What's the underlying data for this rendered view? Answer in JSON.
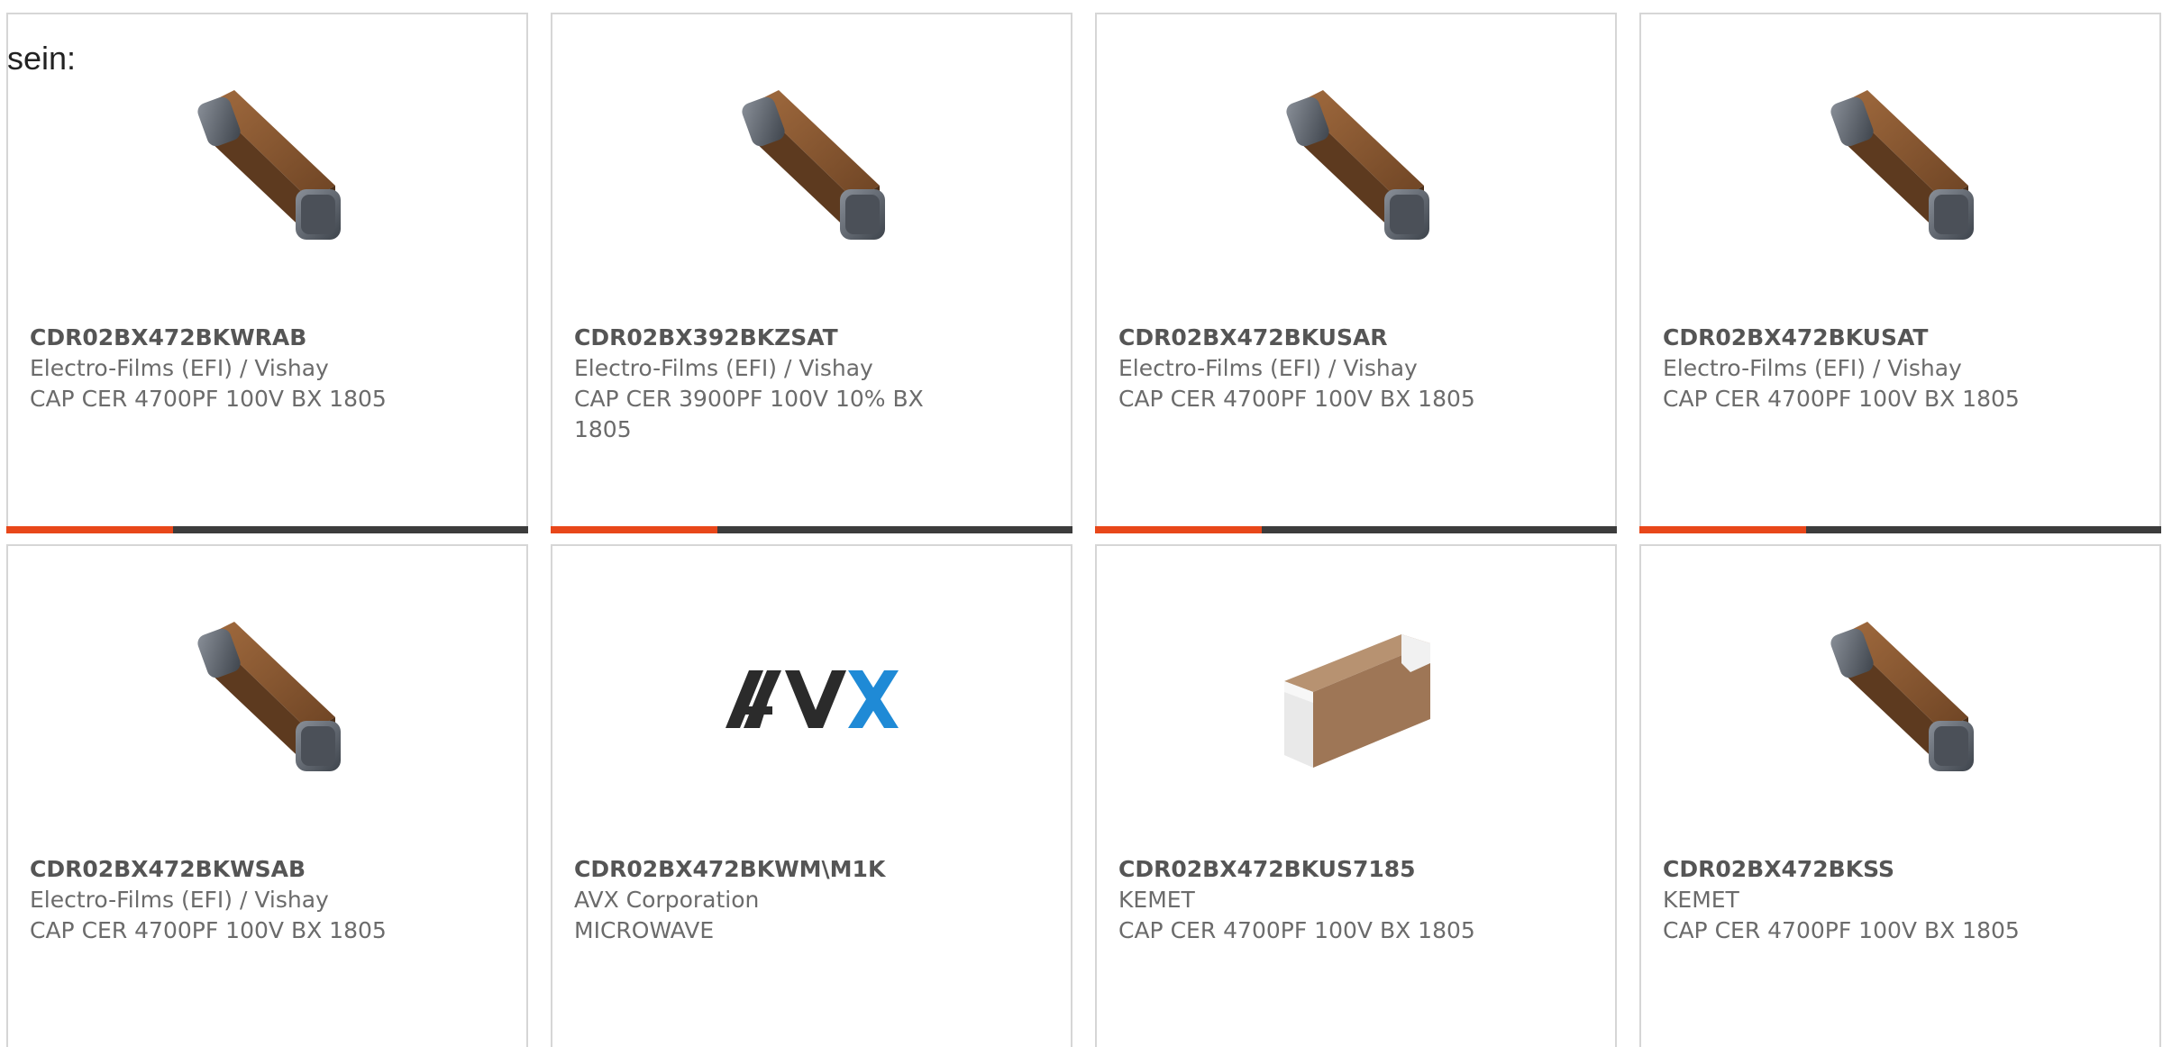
{
  "intro_text": "sein:",
  "colors": {
    "accent": "#e8471a",
    "bar_dark": "#3c3c3c",
    "border": "#d6d6d6",
    "part_number": "#555555",
    "body_text": "#6b6b6b",
    "avx_dark": "#2b2b2b",
    "avx_blue": "#1f8ad6"
  },
  "progress_fraction": 0.32,
  "products": [
    {
      "part_number": "CDR02BX472BKWRAB",
      "manufacturer": "Electro-Films (EFI) / Vishay",
      "description": "CAP CER 4700PF 100V BX 1805",
      "image": "vishay-chip-capacitor"
    },
    {
      "part_number": "CDR02BX392BKZSAT",
      "manufacturer": "Electro-Films (EFI) / Vishay",
      "description": "CAP CER 3900PF 100V 10% BX 1805",
      "image": "vishay-chip-capacitor"
    },
    {
      "part_number": "CDR02BX472BKUSAR",
      "manufacturer": "Electro-Films (EFI) / Vishay",
      "description": "CAP CER 4700PF 100V BX 1805",
      "image": "vishay-chip-capacitor"
    },
    {
      "part_number": "CDR02BX472BKUSAT",
      "manufacturer": "Electro-Films (EFI) / Vishay",
      "description": "CAP CER 4700PF 100V BX 1805",
      "image": "vishay-chip-capacitor"
    },
    {
      "part_number": "CDR02BX472BKWSAB",
      "manufacturer": "Electro-Films (EFI) / Vishay",
      "description": "CAP CER 4700PF 100V BX 1805",
      "image": "vishay-chip-capacitor"
    },
    {
      "part_number": "CDR02BX472BKWM\\M1K",
      "manufacturer": "AVX Corporation",
      "description": "MICROWAVE",
      "image": "avx-logo"
    },
    {
      "part_number": "CDR02BX472BKUS7185",
      "manufacturer": "KEMET",
      "description": "CAP CER 4700PF 100V BX 1805",
      "image": "kemet-chip-capacitor"
    },
    {
      "part_number": "CDR02BX472BKSS",
      "manufacturer": "KEMET",
      "description": "CAP CER 4700PF 100V BX 1805",
      "image": "vishay-chip-capacitor"
    }
  ]
}
